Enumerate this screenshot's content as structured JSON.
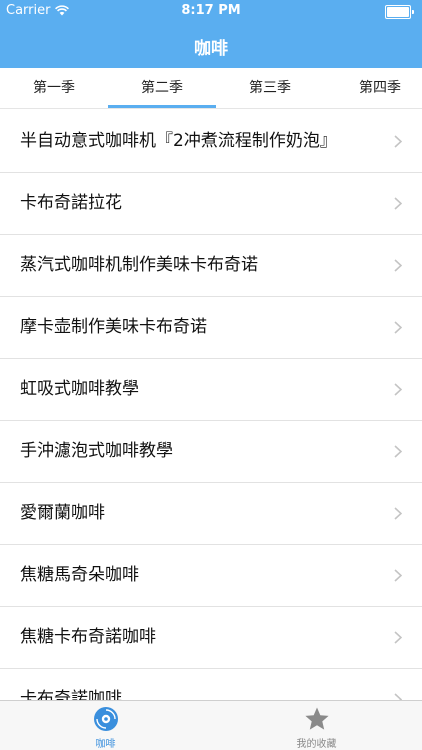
{
  "status_bar": {
    "carrier": "Carrier",
    "time": "8:17 PM",
    "battery_level": 1.0
  },
  "nav": {
    "title": "咖啡"
  },
  "tabs": [
    {
      "label": "第一季"
    },
    {
      "label": "第二季",
      "selected": true
    },
    {
      "label": "第三季"
    },
    {
      "label": "第四季"
    }
  ],
  "items": [
    {
      "label": "半自动意式咖啡机『2冲煮流程制作奶泡』"
    },
    {
      "label": "卡布奇諾拉花"
    },
    {
      "label": "蒸汽式咖啡机制作美味卡布奇诺"
    },
    {
      "label": "摩卡壶制作美味卡布奇诺"
    },
    {
      "label": "虹吸式咖啡教學"
    },
    {
      "label": "手沖濾泡式咖啡教學"
    },
    {
      "label": "愛爾蘭咖啡"
    },
    {
      "label": "焦糖馬奇朵咖啡"
    },
    {
      "label": "焦糖卡布奇諾咖啡"
    },
    {
      "label": "卡布奇諾咖啡"
    }
  ],
  "tabbar": {
    "coffee_label": "咖啡",
    "favorites_label": "我的收藏",
    "coffee_icon": "coffee-disc-icon",
    "favorites_icon": "star-icon"
  },
  "colors": {
    "accent": "#5aaef0",
    "tabbar_active": "#3a8fdd",
    "tabbar_inactive": "#888888"
  }
}
